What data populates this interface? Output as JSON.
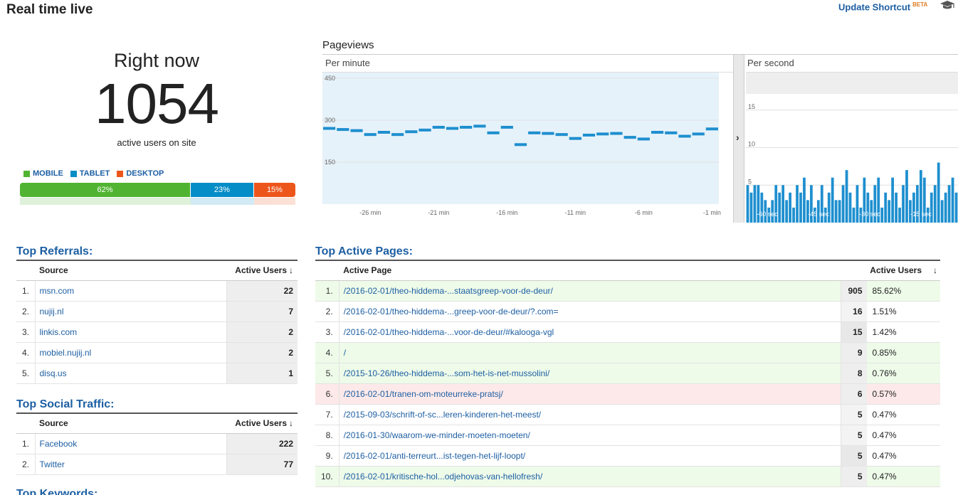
{
  "header": {
    "title": "Real time live",
    "shortcut_label": "Update Shortcut",
    "beta_label": "BETA",
    "help_icon": "graduation-cap-icon"
  },
  "right_now": {
    "label": "Right now",
    "count": "1054",
    "subtitle": "active users on site"
  },
  "devices": {
    "legend": [
      {
        "label": "MOBILE",
        "color": "#50b432"
      },
      {
        "label": "TABLET",
        "color": "#058dc7"
      },
      {
        "label": "DESKTOP",
        "color": "#ed561b"
      }
    ],
    "bar": [
      {
        "label": "62%",
        "value": 62,
        "color": "#50b432"
      },
      {
        "label": "23%",
        "value": 23,
        "color": "#058dc7"
      },
      {
        "label": "15%",
        "value": 15,
        "color": "#ed561b"
      }
    ]
  },
  "pageviews": {
    "title": "Pageviews",
    "per_minute_label": "Per minute",
    "per_second_label": "Per second",
    "expand_icon": "chevron-right-icon"
  },
  "chart_data": [
    {
      "type": "bar",
      "title": "Per minute",
      "ylim": [
        0,
        450
      ],
      "yticks": [
        "450",
        "300",
        "150"
      ],
      "xticks": [
        "-26 min",
        "-21 min",
        "-16 min",
        "-11 min",
        "-6 min",
        "-1 min"
      ],
      "x": [
        -29,
        -28,
        -27,
        -26,
        -25,
        -24,
        -23,
        -22,
        -21,
        -20,
        -19,
        -18,
        -17,
        -16,
        -15,
        -14,
        -13,
        -12,
        -11,
        -10,
        -9,
        -8,
        -7,
        -6,
        -5,
        -4,
        -3,
        -2,
        -1
      ],
      "values": [
        272,
        268,
        264,
        250,
        258,
        250,
        260,
        266,
        276,
        272,
        276,
        280,
        256,
        276,
        214,
        256,
        254,
        250,
        236,
        248,
        252,
        254,
        240,
        234,
        258,
        256,
        244,
        252,
        270
      ]
    },
    {
      "type": "bar",
      "title": "Per second",
      "ylim": [
        0,
        20
      ],
      "yticks": [
        "15",
        "10",
        "5"
      ],
      "xticks": [
        "-60 sec",
        "-45 sec",
        "-30 sec",
        "-15 sec"
      ],
      "values": [
        5,
        4,
        5,
        5,
        4,
        3,
        2,
        3,
        5,
        4,
        5,
        3,
        4,
        2,
        5,
        4,
        6,
        3,
        5,
        2,
        3,
        5,
        2,
        4,
        6,
        3,
        3,
        5,
        7,
        4,
        2,
        5,
        2,
        6,
        4,
        3,
        5,
        6,
        2,
        4,
        3,
        6,
        4,
        2,
        5,
        7,
        3,
        4,
        5,
        7,
        6,
        2,
        4,
        5,
        8,
        3,
        4,
        5,
        6,
        4
      ]
    }
  ],
  "top_referrals": {
    "title": "Top Referrals:",
    "col_source": "Source",
    "col_users": "Active Users",
    "rows": [
      {
        "idx": "1.",
        "source": "msn.com",
        "users": "22"
      },
      {
        "idx": "2.",
        "source": "nujij.nl",
        "users": "7"
      },
      {
        "idx": "3.",
        "source": "linkis.com",
        "users": "2"
      },
      {
        "idx": "4.",
        "source": "mobiel.nujij.nl",
        "users": "2"
      },
      {
        "idx": "5.",
        "source": "disq.us",
        "users": "1"
      }
    ]
  },
  "top_social": {
    "title": "Top Social Traffic:",
    "col_source": "Source",
    "col_users": "Active Users",
    "rows": [
      {
        "idx": "1.",
        "source": "Facebook",
        "users": "222"
      },
      {
        "idx": "2.",
        "source": "Twitter",
        "users": "77"
      }
    ]
  },
  "top_keywords": {
    "title": "Top Keywords:"
  },
  "top_pages": {
    "title": "Top Active Pages:",
    "col_page": "Active Page",
    "col_users": "Active Users",
    "rows": [
      {
        "idx": "1.",
        "page": "/2016-02-01/theo-hiddema-...staatsgreep-voor-de-deur/",
        "users": "905",
        "pct": "85.62%"
      },
      {
        "idx": "2.",
        "page": "/2016-02-01/theo-hiddema-...greep-voor-de-deur/?.com=",
        "users": "16",
        "pct": "1.51%"
      },
      {
        "idx": "3.",
        "page": "/2016-02-01/theo-hiddema-...voor-de-deur/#kalooga-vgl",
        "users": "15",
        "pct": "1.42%"
      },
      {
        "idx": "4.",
        "page": "/",
        "users": "9",
        "pct": "0.85%"
      },
      {
        "idx": "5.",
        "page": "/2015-10-26/theo-hiddema-...som-het-is-net-mussolini/",
        "users": "8",
        "pct": "0.76%"
      },
      {
        "idx": "6.",
        "page": "/2016-02-01/tranen-om-moteurreke-pratsj/",
        "users": "6",
        "pct": "0.57%"
      },
      {
        "idx": "7.",
        "page": "/2015-09-03/schrift-of-sc...leren-kinderen-het-meest/",
        "users": "5",
        "pct": "0.47%"
      },
      {
        "idx": "8.",
        "page": "/2016-01-30/waarom-we-minder-moeten-moeten/",
        "users": "5",
        "pct": "0.47%"
      },
      {
        "idx": "9.",
        "page": "/2016-02-01/anti-terreurt...ist-tegen-het-lijf-loopt/",
        "users": "5",
        "pct": "0.47%"
      },
      {
        "idx": "10.",
        "page": "/2016-02-01/kritische-hol...odjehovas-van-hellofresh/",
        "users": "5",
        "pct": "0.47%"
      }
    ]
  }
}
